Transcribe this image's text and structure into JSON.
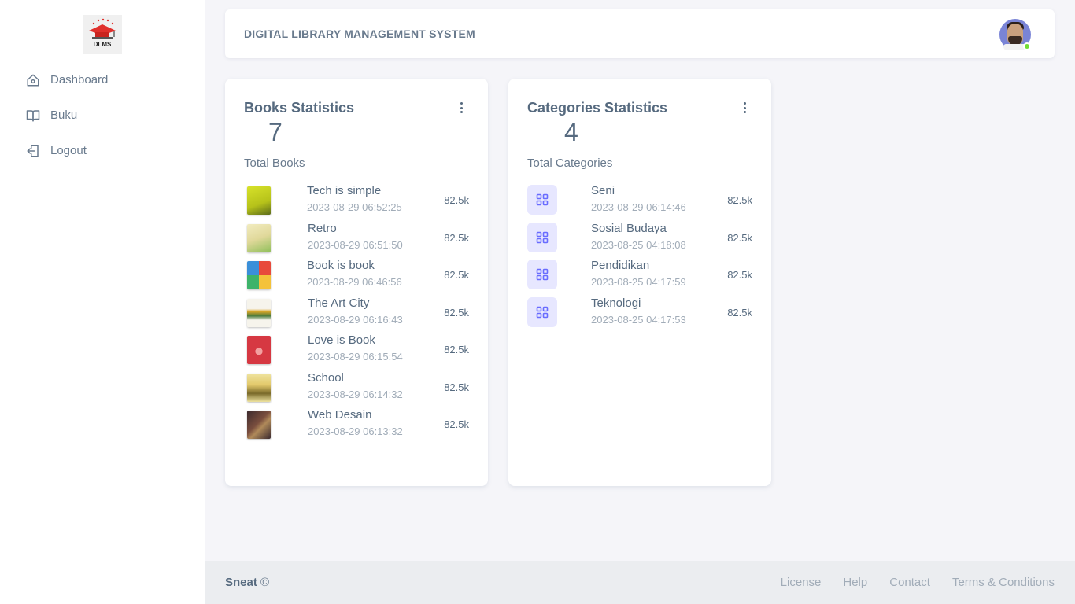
{
  "sidebar": {
    "logo_text": "DLMS",
    "items": [
      {
        "label": "Dashboard",
        "icon": "home-icon"
      },
      {
        "label": "Buku",
        "icon": "book-open-icon"
      },
      {
        "label": "Logout",
        "icon": "logout-icon"
      }
    ]
  },
  "navbar": {
    "title": "DIGITAL LIBRARY MANAGEMENT SYSTEM",
    "status_color": "#71dd37"
  },
  "books_card": {
    "title": "Books Statistics",
    "total": "7",
    "total_label": "Total Books",
    "items": [
      {
        "name": "Tech is simple",
        "date": "2023-08-29 06:52:25",
        "value": "82.5k",
        "cover": "#c7d41f"
      },
      {
        "name": "Retro",
        "date": "2023-08-29 06:51:50",
        "value": "82.5k",
        "cover": "#e7e0a6"
      },
      {
        "name": "Book is book",
        "date": "2023-08-29 06:46:56",
        "value": "82.5k",
        "cover": "#3db36a"
      },
      {
        "name": "The Art City",
        "date": "2023-08-29 06:16:43",
        "value": "82.5k",
        "cover": "#f1efe6"
      },
      {
        "name": "Love is Book",
        "date": "2023-08-29 06:15:54",
        "value": "82.5k",
        "cover": "#d63842"
      },
      {
        "name": "School",
        "date": "2023-08-29 06:14:32",
        "value": "82.5k",
        "cover": "#e9dc8c"
      },
      {
        "name": "Web Desain",
        "date": "2023-08-29 06:13:32",
        "value": "82.5k",
        "cover": "#6b4a3e"
      }
    ]
  },
  "categories_card": {
    "title": "Categories Statistics",
    "total": "4",
    "total_label": "Total Categories",
    "items": [
      {
        "name": "Seni",
        "date": "2023-08-29 06:14:46",
        "value": "82.5k"
      },
      {
        "name": "Sosial Budaya",
        "date": "2023-08-25 04:18:08",
        "value": "82.5k"
      },
      {
        "name": "Pendidikan",
        "date": "2023-08-25 04:17:59",
        "value": "82.5k"
      },
      {
        "name": "Teknologi",
        "date": "2023-08-25 04:17:53",
        "value": "82.5k"
      }
    ]
  },
  "footer": {
    "brand": "Sneat",
    "copyright": "©",
    "links": [
      "License",
      "Help",
      "Contact",
      "Terms & Conditions"
    ]
  },
  "colors": {
    "accent": "#696cff",
    "accent_bg": "#e7e7ff",
    "background": "#f5f5f9"
  }
}
